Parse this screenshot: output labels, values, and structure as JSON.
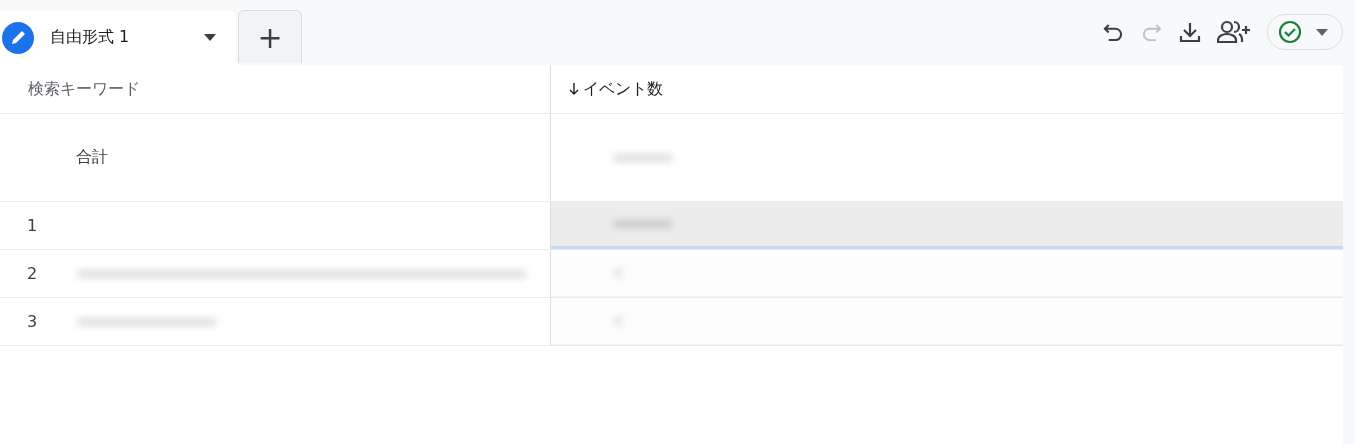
{
  "tabs": [
    {
      "label": "自由形式 1",
      "selected": true
    }
  ],
  "add_tab": {
    "label": "+"
  },
  "table": {
    "columns": [
      {
        "label": "検索キーワード",
        "sorted": false
      },
      {
        "label": "イベント数",
        "sorted": true
      }
    ],
    "total_row": {
      "label": "合計"
    },
    "rows": [
      {
        "rank": "1",
        "highlighted": true
      },
      {
        "rank": "2",
        "highlighted": false
      },
      {
        "rank": "3",
        "highlighted": false
      }
    ]
  }
}
